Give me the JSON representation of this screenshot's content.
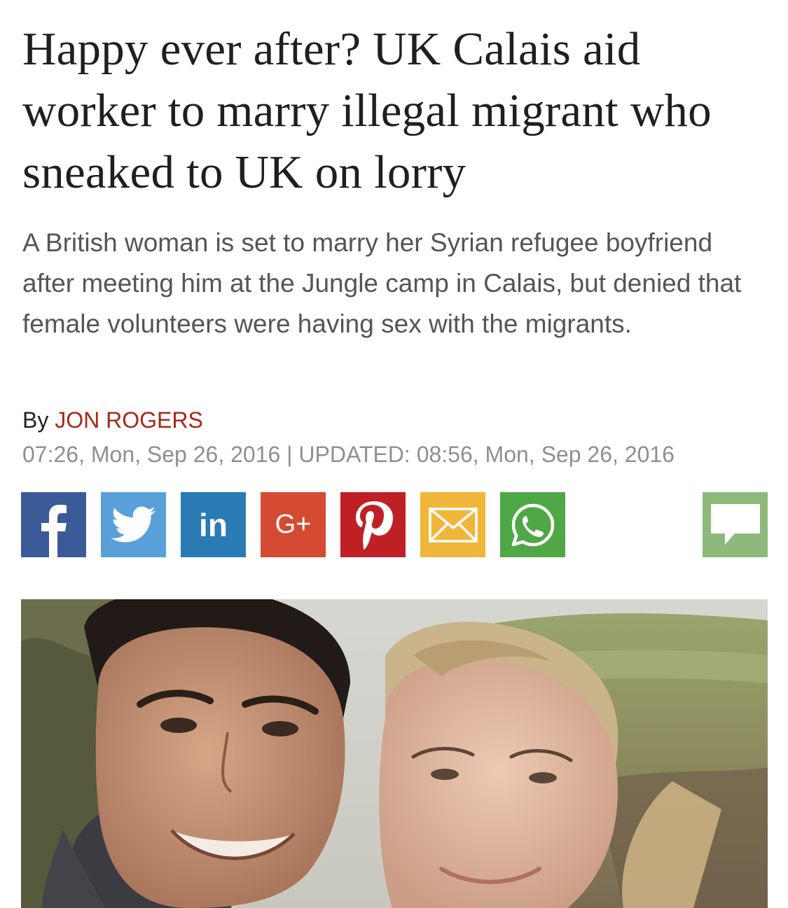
{
  "article": {
    "headline": "Happy ever after? UK Calais aid worker to marry illegal migrant who sneaked to UK on lorry",
    "standfirst": "A British woman is set to marry her Syrian refugee boyfriend after meeting him at the Jungle camp in Calais, but denied that female volunteers were having sex with the migrants.",
    "byline_prefix": "By",
    "author": "JON ROGERS",
    "dateline": "07:26, Mon, Sep 26, 2016 | UPDATED: 08:56, Mon, Sep 26, 2016"
  },
  "share": {
    "buttons": [
      {
        "name": "facebook",
        "icon": "facebook-icon",
        "color": "#3b5a98",
        "glyph": "f"
      },
      {
        "name": "twitter",
        "icon": "twitter-bird-icon",
        "color": "#5aa0d8"
      },
      {
        "name": "linkedin",
        "icon": "linkedin-icon",
        "color": "#2a7bb4",
        "glyph": "in"
      },
      {
        "name": "google-plus",
        "icon": "google-plus-icon",
        "color": "#d54a32",
        "glyph": "G+"
      },
      {
        "name": "pinterest",
        "icon": "pinterest-icon",
        "color": "#bf2026",
        "glyph": "p"
      },
      {
        "name": "email",
        "icon": "envelope-icon",
        "color": "#f0b63a"
      },
      {
        "name": "whatsapp",
        "icon": "whatsapp-icon",
        "color": "#4fa845"
      },
      {
        "name": "comments",
        "icon": "speech-bubble-icon",
        "color": "#8dba7a"
      }
    ]
  },
  "colors": {
    "author_link": "#a6281a",
    "dateline": "#8f8f8f",
    "standfirst": "#555555"
  }
}
